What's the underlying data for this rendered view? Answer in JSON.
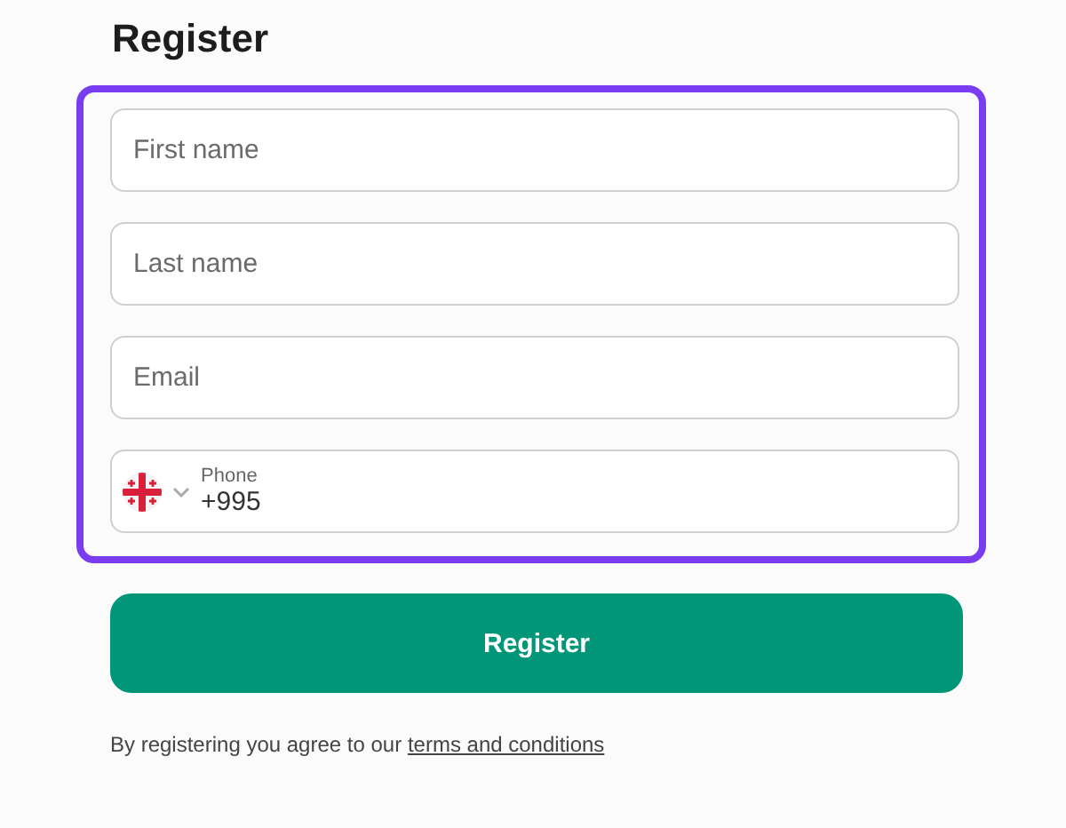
{
  "title": "Register",
  "fields": [
    {
      "kind": "text",
      "placeholder": "First name"
    },
    {
      "kind": "text",
      "placeholder": "Last name"
    },
    {
      "kind": "text",
      "placeholder": "Email"
    },
    {
      "kind": "phone",
      "label": "Phone",
      "value": "+995"
    }
  ],
  "submit": "Register",
  "agreement": {
    "text": "By registering you agree to our ",
    "link": "terms and conditions"
  }
}
